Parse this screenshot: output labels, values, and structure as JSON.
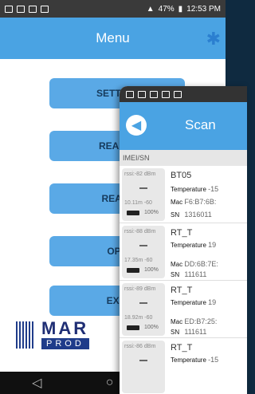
{
  "back_phone": {
    "status_bar": {
      "battery": "47%",
      "time": "12:53 PM"
    },
    "title": "Menu",
    "buttons": [
      "SETTING",
      "READ D",
      "REALT",
      "OPE",
      "EXIT"
    ],
    "logo": {
      "name": "MAR",
      "sub": "PROD"
    },
    "nav": {
      "back": "◁",
      "home": "○"
    }
  },
  "front_phone": {
    "title": "Scan",
    "column_header": "IMEI/SN",
    "devices": [
      {
        "rssi": "rssi:-82 dBm",
        "distance": "10.11m -60",
        "battery": "100%",
        "name": "BT05",
        "temperature_label": "Temperature",
        "temperature": "-15",
        "mac_label": "Mac",
        "mac": "F6:B7:6B:",
        "sn_label": "SN",
        "sn": "1316011"
      },
      {
        "rssi": "rssi:-88 dBm",
        "distance": "17.35m -60",
        "battery": "100%",
        "name": "RT_T",
        "temperature_label": "Temperature",
        "temperature": "19",
        "mac_label": "Mac",
        "mac": "DD:6B:7E:",
        "sn_label": "SN",
        "sn": "111611"
      },
      {
        "rssi": "rssi:-89 dBm",
        "distance": "18.92m -60",
        "battery": "100%",
        "name": "RT_T",
        "temperature_label": "Temperature",
        "temperature": "19",
        "mac_label": "Mac",
        "mac": "ED:B7:25:",
        "sn_label": "SN",
        "sn": "111611"
      },
      {
        "rssi": "rssi:-86 dBm",
        "distance": "",
        "battery": "",
        "name": "RT_T",
        "temperature_label": "Temperature",
        "temperature": "-15",
        "mac_label": "",
        "mac": "",
        "sn_label": "",
        "sn": ""
      }
    ]
  },
  "colors": {
    "accent": "#4aa3e3",
    "button": "#5aa9e6",
    "logo": "#1f3c8a"
  }
}
